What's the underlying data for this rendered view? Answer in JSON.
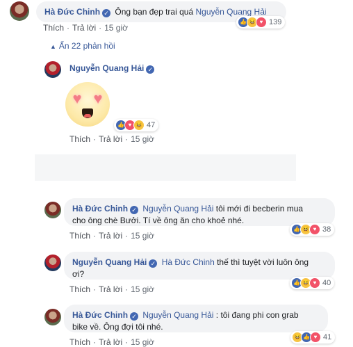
{
  "comment1": {
    "author": "Hà Đức Chinh",
    "text": "Ông bạn đẹp trai quá",
    "mention": "Nguyễn Quang Hải",
    "like_label": "Thích",
    "reply_label": "Trả lời",
    "time": "15 giờ",
    "reaction_count": "139"
  },
  "hidden_replies": "Ẩn 22 phản hồi",
  "reply_sticker": {
    "author": "Nguyễn Quang Hải",
    "like_label": "Thích",
    "reply_label": "Trả lời",
    "time": "15 giờ",
    "reaction_count": "47"
  },
  "reply2": {
    "author": "Hà Đức Chinh",
    "mention": "Nguyễn Quang Hải",
    "text_line1": "tôi mới đi becberin mua",
    "text_line2": "cho ông chè Bưởi. Tí về ông ăn cho khoẻ nhé.",
    "like_label": "Thích",
    "reply_label": "Trả lời",
    "time": "15 giờ",
    "reaction_count": "38"
  },
  "reply3": {
    "author": "Nguyễn Quang Hải",
    "mention": "Hà Đức Chinh",
    "text_line1": "thế thì tuyệt vời luôn ông",
    "text_line2": "ơi?",
    "like_label": "Thích",
    "reply_label": "Trả lời",
    "time": "15 giờ",
    "reaction_count": "40"
  },
  "reply4": {
    "author": "Hà Đức Chinh",
    "mention": "Nguyễn Quang Hải",
    "text_line1": ": tôi đang phi con grab",
    "text_line2": "bike về. Ông đợi tôi nhé.",
    "like_label": "Thích",
    "reply_label": "Trả lời",
    "time": "15 giờ",
    "reaction_count": "41"
  },
  "icons": {
    "like": "like-icon",
    "haha": "haha-icon",
    "love": "love-icon",
    "verified": "verified-badge-icon",
    "collapse": "collapse-arrow-icon"
  },
  "colors": {
    "link": "#385898",
    "bubble": "#f2f3f5",
    "like": "#4267b2",
    "love": "#f25268",
    "haha": "#f7c443"
  }
}
